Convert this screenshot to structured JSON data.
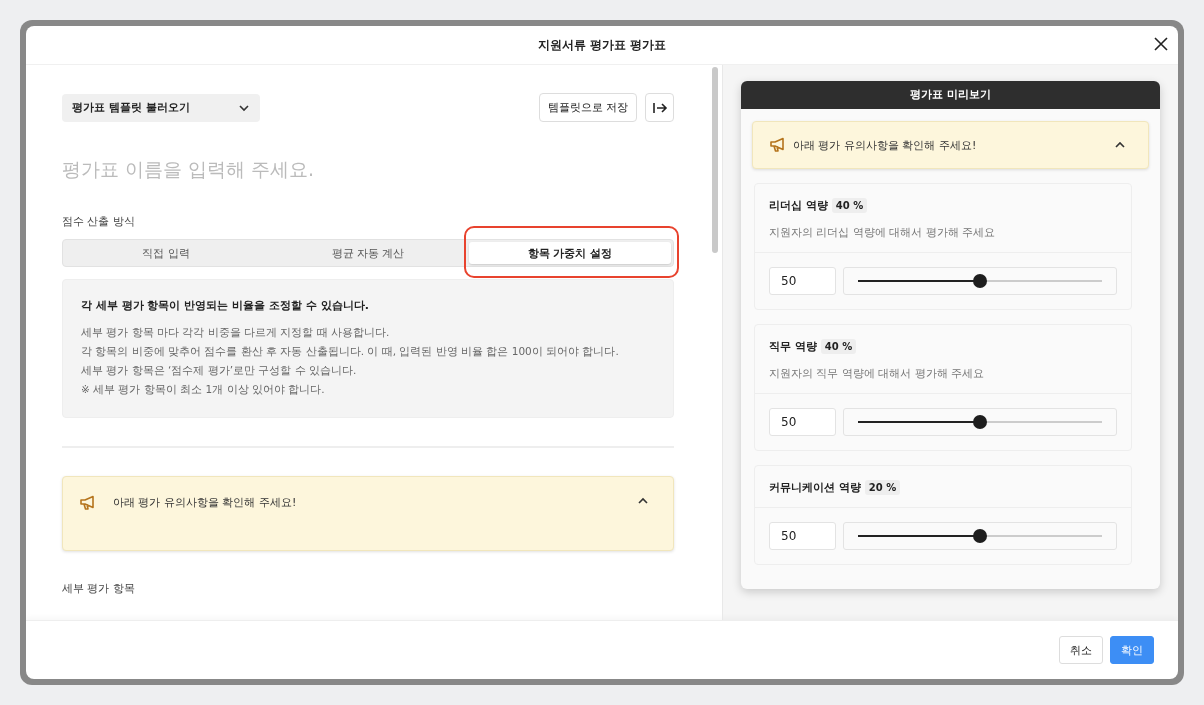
{
  "window": {
    "title": "지원서류 평가표 평가표"
  },
  "toolbar": {
    "template_dropdown": "평가표 템플릿 불러오기",
    "save_template": "템플릿으로 저장"
  },
  "name_field": {
    "placeholder": "평가표 이름을 입력해 주세요."
  },
  "score_method": {
    "label": "점수 산출 방식",
    "tabs": [
      {
        "label": "직접 입력",
        "selected": false
      },
      {
        "label": "평균 자동 계산",
        "selected": false
      },
      {
        "label": "항목 가중치 설정",
        "selected": true
      }
    ]
  },
  "info": {
    "heading": "각 세부 평가 항목이 반영되는 비율을 조정할 수 있습니다.",
    "lines": [
      "세부 평가 항목 마다 각각 비중을 다르게 지정할 때 사용합니다.",
      "각 항목의 비중에 맞추어 점수를 환산 후 자동 산출됩니다. 이 때, 입력된 반영 비율 합은 100이 되어야 합니다.",
      "세부 평가 항목은 ‘점수제 평가’로만 구성할 수 있습니다.",
      "※ 세부 평가 항목이 최소 1개 이상 있어야 합니다."
    ]
  },
  "notice": {
    "text": "아래 평가 유의사항을 확인해 주세요!",
    "expanded": true
  },
  "detail_section": {
    "label": "세부 평가 항목"
  },
  "preview": {
    "title": "평가표 미리보기",
    "notice": {
      "text": "아래 평가 유의사항을 확인해 주세요!",
      "expanded": true
    },
    "items": [
      {
        "name": "리더십 역량",
        "weight": "40 %",
        "description": "지원자의 리더십 역량에 대해서 평가해 주세요",
        "value": "50",
        "level": 0.5
      },
      {
        "name": "직무 역량",
        "weight": "40 %",
        "description": "지원자의 직무 역량에 대해서 평가해 주세요",
        "value": "50",
        "level": 0.5
      },
      {
        "name": "커뮤니케이션 역량",
        "weight": "20 %",
        "value": "50",
        "level": 0.5
      }
    ]
  },
  "footer": {
    "buttons": [
      {
        "label": "취소",
        "kind": "secondary"
      },
      {
        "label": "확인",
        "kind": "primary"
      }
    ]
  }
}
